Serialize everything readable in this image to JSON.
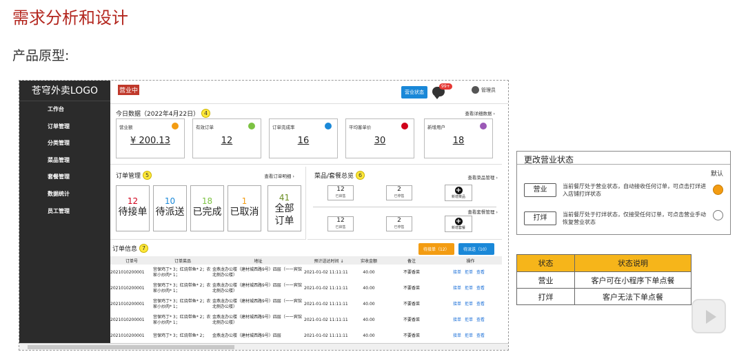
{
  "slide": {
    "title": "需求分析和设计",
    "subtitle": "产品原型:"
  },
  "app": {
    "logo": "苍穹外卖LOGO",
    "status_tag": "营业中",
    "status_button": "营业状态",
    "msg_badge": "99+",
    "admin": "管理员",
    "sidebar": [
      "工作台",
      "订单管理",
      "分类管理",
      "菜品管理",
      "套餐管理",
      "数据统计",
      "员工管理"
    ]
  },
  "today": {
    "title": "今日数据（2022年4月22日）",
    "marker": "4",
    "more": "查看详细数据",
    "kpis": [
      {
        "label": "营业额",
        "value": "¥ 200.13",
        "color": "#f39c12",
        "icon": "yuan-icon"
      },
      {
        "label": "有效订单",
        "value": "12",
        "color": "#7cc242",
        "icon": "order-icon"
      },
      {
        "label": "订单完成率",
        "value": "16",
        "color": "#1a88d8",
        "icon": "percent-icon"
      },
      {
        "label": "平均客单价",
        "value": "30",
        "color": "#d0021b",
        "icon": "price-icon"
      },
      {
        "label": "新增用户",
        "value": "18",
        "color": "#9b59b6",
        "icon": "user-icon"
      }
    ]
  },
  "orders": {
    "title": "订单管理",
    "marker": "5",
    "more": "查看订单明细",
    "boxes": [
      {
        "num": "12",
        "label": "待接单",
        "color": "#d0021b"
      },
      {
        "num": "10",
        "label": "待派送",
        "color": "#1a88d8"
      },
      {
        "num": "18",
        "label": "已完成",
        "color": "#7cc242"
      },
      {
        "num": "1",
        "label": "已取消",
        "color": "#f39c12"
      },
      {
        "num": "41",
        "label": "全部订单",
        "color": "#6b8e23"
      }
    ]
  },
  "dishes": {
    "title": "菜品/套餐总览",
    "marker": "6",
    "more_dish": "查看菜品管理",
    "more_combo": "查看套餐管理",
    "dish_on": "12",
    "dish_on_lbl": "已启售",
    "dish_off": "2",
    "dish_off_lbl": "已停售",
    "dish_new": "新增菜品",
    "combo_on": "12",
    "combo_on_lbl": "已启售",
    "combo_off": "2",
    "combo_off_lbl": "已停售",
    "combo_new": "新增套餐"
  },
  "info": {
    "title": "订单信息",
    "marker": "7",
    "btn_pending": "待接单（12）",
    "btn_deliver": "待派送（10）",
    "headers": [
      "订单号",
      "订单菜品",
      "地址",
      "预计送达时间 ↓",
      "实收金额",
      "备注",
      "操作"
    ],
    "rows": [
      {
        "id": "2021010200001",
        "dish": "宫保鸡丁* 3；红烧带鱼* 2；农家小炒肉* 1；",
        "addr": "金燕龙办公楼（建材城西路9号）四层（一一宾馆北侧办公楼）",
        "time": "2021-01-02 11:11:11",
        "amount": "40.00",
        "note": "不要香菜"
      },
      {
        "id": "2021010200001",
        "dish": "宫保鸡丁* 3；红烧带鱼* 2；农家小炒肉* 1；",
        "addr": "金燕龙办公楼（建材城西路9号）四层（一一宾馆北侧办公楼）",
        "time": "2021-01-02 11:11:11",
        "amount": "40.00",
        "note": "不要香菜"
      },
      {
        "id": "2021010200001",
        "dish": "宫保鸡丁* 3；红烧带鱼* 2；农家小炒肉* 1；",
        "addr": "金燕龙办公楼（建材城西路9号）四层（一一宾馆北侧办公楼）",
        "time": "2021-01-02 11:11:11",
        "amount": "40.00",
        "note": "不要香菜"
      },
      {
        "id": "2021010200001",
        "dish": "宫保鸡丁* 3；红烧带鱼* 2；农家小炒肉* 1；",
        "addr": "金燕龙办公楼（建材城西路9号）四层（一一宾馆北侧办公楼）",
        "time": "2021-01-02 11:11:11",
        "amount": "40.00",
        "note": "不要香菜"
      },
      {
        "id": "2021010200001",
        "dish": "宫保鸡丁* 3；红烧带鱼* 2；",
        "addr": "金燕龙办公楼（建材城西路9号）四层",
        "time": "2021-01-02 11:11:11",
        "amount": "40.00",
        "note": "不要香菜"
      }
    ],
    "actions": [
      "接单",
      "拒单",
      "查看"
    ]
  },
  "change": {
    "title": "更改营业状态",
    "default": "默认",
    "open_btn": "营业",
    "open_desc": "当前餐厅处于营业状态，自动接收任何订单，可点击打烊进入店铺打烊状态",
    "close_btn": "打烊",
    "close_desc": "当前餐厅处于打烊状态，仅接受任何订单，可点击营业手动恢复营业状态",
    "selected_color": "#f39c12"
  },
  "status_table": {
    "headers": [
      "状态",
      "状态说明"
    ],
    "rows": [
      [
        "营业",
        "客户可在小程序下单点餐"
      ],
      [
        "打烊",
        "客户无法下单点餐"
      ]
    ]
  }
}
